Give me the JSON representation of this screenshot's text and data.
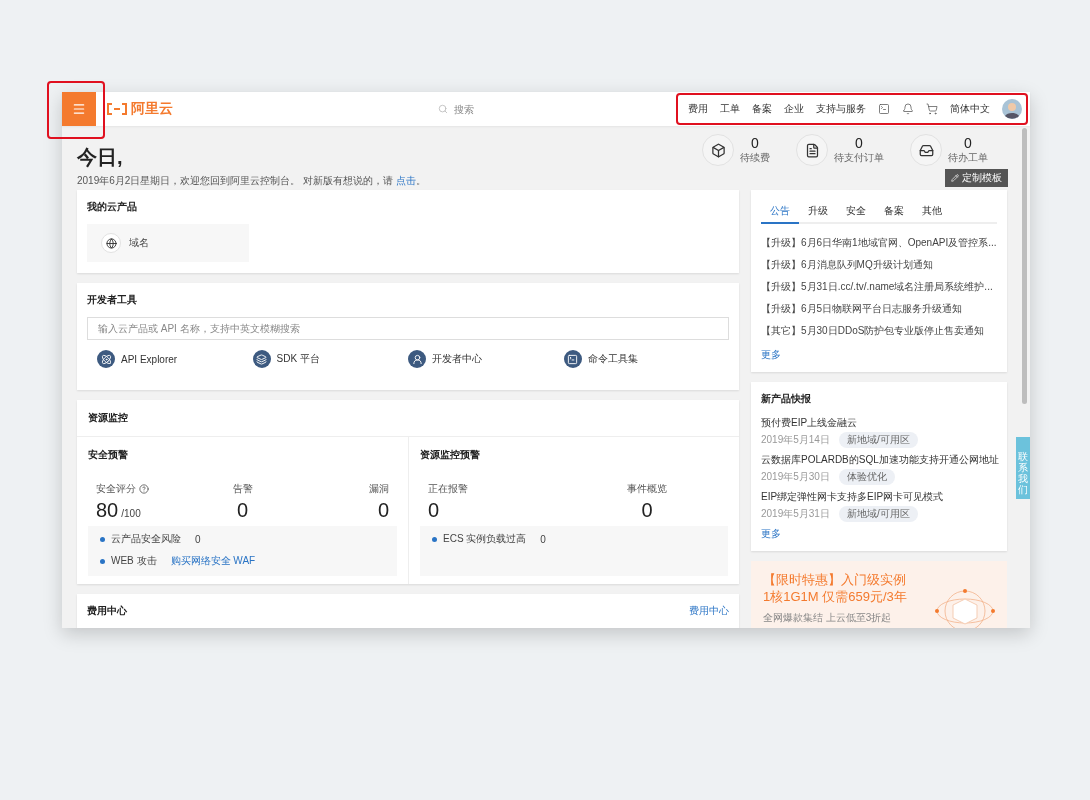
{
  "header": {
    "menu_button": {
      "highlighted": true
    },
    "logo": "阿里云",
    "search": {
      "placeholder": "搜索"
    },
    "nav": {
      "highlighted": true,
      "items": [
        {
          "kind": "text",
          "label": "费用"
        },
        {
          "kind": "text",
          "label": "工单"
        },
        {
          "kind": "text",
          "label": "备案"
        },
        {
          "kind": "text",
          "label": "企业"
        },
        {
          "kind": "text",
          "label": "支持与服务"
        },
        {
          "kind": "terminal"
        },
        {
          "kind": "bell"
        },
        {
          "kind": "cart"
        },
        {
          "kind": "text",
          "label": "简体中文"
        },
        {
          "kind": "avatar"
        }
      ]
    }
  },
  "greeting": {
    "title": "今日,",
    "subtitle": "2019年6月2日星期日，欢迎您回到阿里云控制台。 对新版有想说的，请",
    "link": "点击",
    "end": "。"
  },
  "stats": [
    {
      "kind": "box",
      "value": "0",
      "label": "待续费"
    },
    {
      "kind": "doc",
      "value": "0",
      "label": "待支付订单"
    },
    {
      "kind": "inbox",
      "value": "0",
      "label": "待办工单"
    }
  ],
  "customize_button": "定制模板",
  "my_products": {
    "title": "我的云产品",
    "items": [
      {
        "kind": "globe",
        "label": "域名"
      }
    ]
  },
  "dev_tools": {
    "title": "开发者工具",
    "search": {
      "placeholder": "输入云产品或 API 名称，支持中英文模糊搜索"
    },
    "tools": [
      {
        "kind": "api",
        "label": "API Explorer"
      },
      {
        "kind": "sdk",
        "label": "SDK 平台"
      },
      {
        "kind": "dev",
        "label": "开发者中心"
      },
      {
        "kind": "cli",
        "label": "命令工具集"
      }
    ]
  },
  "monitoring": {
    "title": "资源监控",
    "panels": [
      {
        "title": "安全预警",
        "metrics": [
          {
            "label": "安全评分",
            "help": true,
            "value": "80",
            "suffix": "/100"
          },
          {
            "label": "告警",
            "value": "0"
          },
          {
            "label": "漏洞",
            "value": "0"
          }
        ],
        "rows": [
          {
            "label": "云产品安全风险",
            "value": "0"
          },
          {
            "label": "WEB 攻击",
            "link": "购买网络安全 WAF"
          }
        ]
      },
      {
        "title": "资源监控预警",
        "metrics": [
          {
            "label": "正在报警",
            "value": "0"
          },
          {
            "label": "事件概览",
            "value": "0"
          }
        ],
        "rows": [
          {
            "label": "ECS 实例负载过高",
            "value": "0"
          }
        ]
      }
    ]
  },
  "billing": {
    "title": "费用中心",
    "link": "费用中心"
  },
  "notices": {
    "tabs": [
      {
        "label": "公告",
        "selected": true
      },
      {
        "label": "升级",
        "selected": false
      },
      {
        "label": "安全",
        "selected": false
      },
      {
        "label": "备案",
        "selected": false
      },
      {
        "label": "其他",
        "selected": false
      }
    ],
    "items": [
      "【升级】6月6日华南1地域官网、OpenAPI及管控系...",
      "【升级】6月消息队列MQ升级计划通知",
      "【升级】5月31日.cc/.tv/.name域名注册局系统维护...",
      "【升级】6月5日物联网平台日志服务升级通知",
      "【其它】5月30日DDoS防护包专业版停止售卖通知"
    ],
    "more": "更多"
  },
  "new_products": {
    "title": "新产品快报",
    "items": [
      {
        "title": "预付费EIP上线金融云",
        "date": "2019年5月14日",
        "tag": "新地域/可用区"
      },
      {
        "title": "云数据库POLARDB的SQL加速功能支持开通公网地址",
        "date": "2019年5月30日",
        "tag": "体验优化"
      },
      {
        "title": "EIP绑定弹性网卡支持多EIP网卡可见模式",
        "date": "2019年5月31日",
        "tag": "新地域/可用区"
      }
    ],
    "more": "更多"
  },
  "promo": {
    "title": "【限时特惠】入门级实例",
    "title2": "1核1G1M 仅需659元/3年",
    "subtitle": "全网爆款集结 上云低至3折起"
  },
  "contact_tab": "联系我们"
}
